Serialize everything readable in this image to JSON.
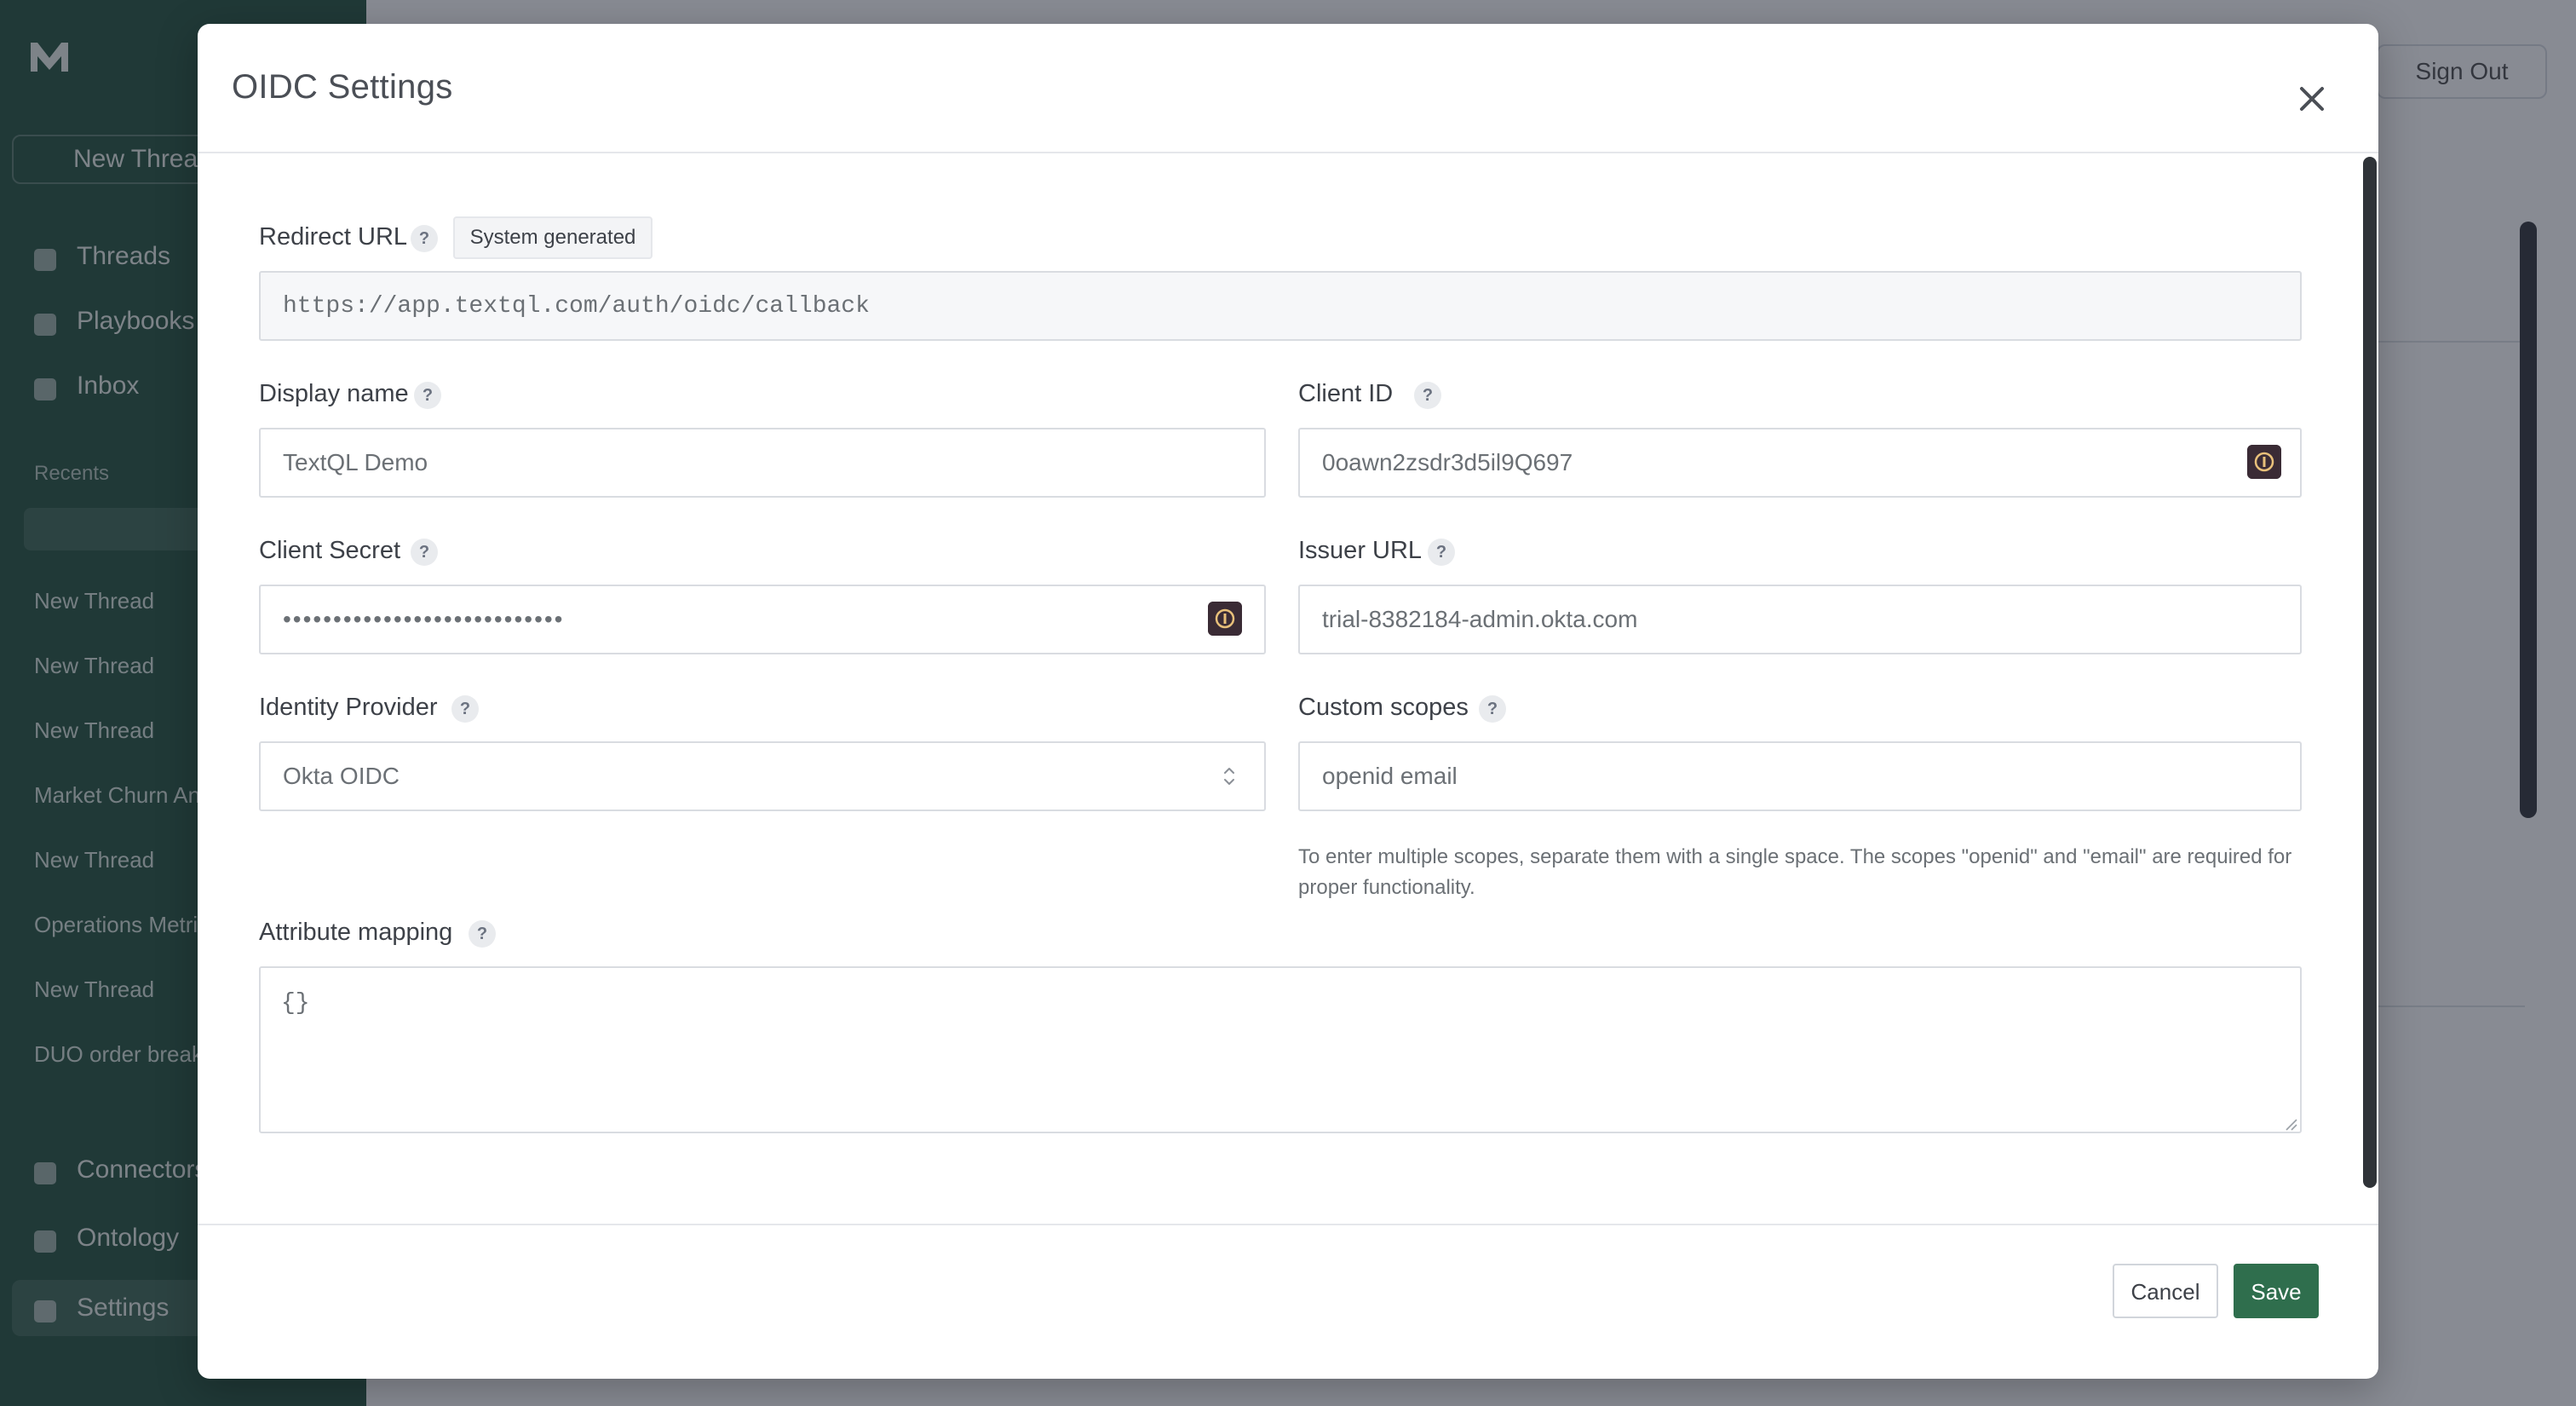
{
  "background": {
    "nav": [
      "Threads",
      "Playbooks",
      "Inbox"
    ],
    "new_thread": "New Thread",
    "recent_label": "Recents",
    "recent_items": [
      "New Thread",
      "New Thread",
      "New Thread",
      "Market Churn Analysis",
      "New Thread",
      "Operations Metrics",
      "New Thread",
      "DUO order breakdown"
    ],
    "bottom_nav": [
      "Connectors",
      "Ontology",
      "Settings"
    ],
    "sign_out": "Sign Out"
  },
  "modal": {
    "title": "OIDC Settings",
    "fields": {
      "redirect_url": {
        "label": "Redirect URL",
        "badge": "System generated",
        "value": "https://app.textql.com/auth/oidc/callback"
      },
      "display_name": {
        "label": "Display name",
        "value": "TextQL Demo"
      },
      "client_id": {
        "label": "Client ID",
        "value": "0oawn2zsdr3d5il9Q697"
      },
      "client_secret": {
        "label": "Client Secret",
        "value": "••••••••••••••••••••••••••••"
      },
      "issuer_url": {
        "label": "Issuer URL",
        "value": "trial-8382184-admin.okta.com"
      },
      "identity_provider": {
        "label": "Identity Provider",
        "value": "Okta OIDC"
      },
      "custom_scopes": {
        "label": "Custom scopes",
        "value": "openid email",
        "help": "To enter multiple scopes, separate them with a single space. The scopes \"openid\" and \"email\" are required for proper functionality."
      },
      "attribute_mapping": {
        "label": "Attribute mapping",
        "value": "{}"
      }
    },
    "help_mark": "?",
    "buttons": {
      "cancel": "Cancel",
      "save": "Save"
    }
  },
  "colors": {
    "sidebar": "#2e5a46",
    "overlay": "rgba(17,24,39,0.5)",
    "save_button": "#2f6e4d",
    "password_manager_icon": "#3a2b35"
  },
  "icons": [
    "close-icon",
    "help-icon",
    "password-manager-icon",
    "select-chevron-icon",
    "resize-handle-icon"
  ]
}
